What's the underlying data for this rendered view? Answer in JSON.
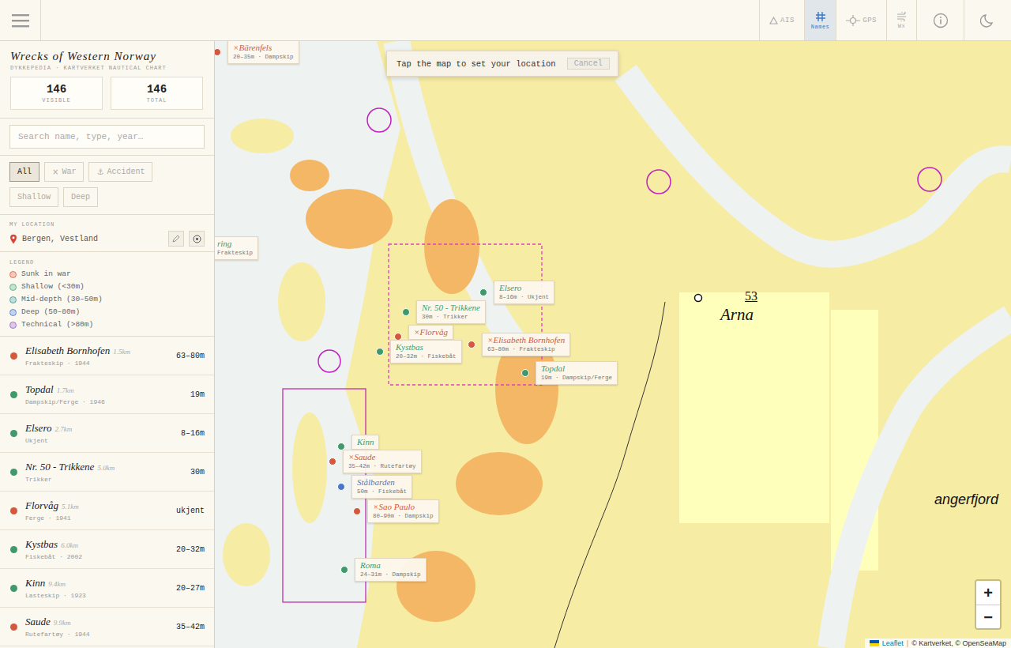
{
  "app": {
    "title": "Wrecks of Western Norway",
    "subtitle": "DYKKEPEDIA · KARTVERKET NAUTICAL CHART"
  },
  "toolbar": {
    "buttons": [
      {
        "label": "AIS",
        "selected": false
      },
      {
        "label": "Names",
        "selected": true
      },
      {
        "label": "GPS",
        "selected": false
      },
      {
        "label": "Wx",
        "selected": false
      }
    ]
  },
  "stats": [
    {
      "value": "146",
      "label": "VISIBLE"
    },
    {
      "value": "146",
      "label": "TOTAL"
    }
  ],
  "search": {
    "placeholder": "Search name, type, year…"
  },
  "filters": [
    {
      "icon": "",
      "label": "All",
      "selected": true
    },
    {
      "icon": "×",
      "label": "War",
      "selected": false
    },
    {
      "icon": "⚓",
      "label": "Accident",
      "selected": false
    },
    {
      "icon": "",
      "label": "Shallow",
      "selected": false
    },
    {
      "icon": "",
      "label": "Deep",
      "selected": false
    }
  ],
  "location": {
    "heading": "MY LOCATION",
    "value": "Bergen, Vestland"
  },
  "legend": {
    "heading": "LEGEND",
    "items": [
      {
        "label": "Sunk in war",
        "color": "#e07050"
      },
      {
        "label": "Shallow (<30m)",
        "color": "#5cb88a"
      },
      {
        "label": "Mid-depth (30–50m)",
        "color": "#4fa8a0"
      },
      {
        "label": "Deep (50–80m)",
        "color": "#5a8ad8"
      },
      {
        "label": "Technical (>80m)",
        "color": "#a070d0"
      }
    ]
  },
  "wrecks": [
    {
      "name": "Elisabeth Bornhofen",
      "distance": "1.5km",
      "meta": "Frakteskip · 1944",
      "depth": "63–80m",
      "color": "#d4583b"
    },
    {
      "name": "Topdal",
      "distance": "1.7km",
      "meta": "Dampskip/Ferge · 1946",
      "depth": "19m",
      "color": "#3e9a6a"
    },
    {
      "name": "Elsero",
      "distance": "2.7km",
      "meta": "Ukjent",
      "depth": "8–16m",
      "color": "#3e9a6a"
    },
    {
      "name": "Nr. 50 - Trikkene",
      "distance": "5.0km",
      "meta": "Trikker",
      "depth": "30m",
      "color": "#3e9a6a"
    },
    {
      "name": "Florvåg",
      "distance": "5.1km",
      "meta": "Ferge · 1941",
      "depth": "ukjent",
      "color": "#d4583b"
    },
    {
      "name": "Kystbas",
      "distance": "6.0km",
      "meta": "Fiskebåt · 2002",
      "depth": "20–32m",
      "color": "#3e9a6a"
    },
    {
      "name": "Kinn",
      "distance": "9.4km",
      "meta": "Lasteskip · 1923",
      "depth": "20–27m",
      "color": "#3e9a6a"
    },
    {
      "name": "Saude",
      "distance": "9.9km",
      "meta": "Rutefartøy · 1944",
      "depth": "35–42m",
      "color": "#d4583b"
    }
  ],
  "map": {
    "war_mark": "×",
    "markers": [
      {
        "name": "Bärenfels",
        "detail": "20–35m · Dampskip",
        "war": true,
        "color": "#d4583b"
      },
      {
        "name": "ring",
        "detail": "Frakteskip",
        "war": false,
        "color": "#3e9a6a"
      },
      {
        "name": "Elsero",
        "detail": "8–16m · Ukjent",
        "war": false,
        "color": "#3e9a6a"
      },
      {
        "name": "Nr. 50 - Trikkene",
        "detail": "30m · Trikker",
        "war": false,
        "color": "#3e9a6a"
      },
      {
        "name": "Florvåg",
        "detail": "",
        "war": true,
        "color": "#d4583b"
      },
      {
        "name": "Kystbas",
        "detail": "20–32m · Fiskebåt",
        "war": false,
        "color": "#3e9a6a"
      },
      {
        "name": "Elisabeth Bornhofen",
        "detail": "63–80m · Frakteskip",
        "war": true,
        "color": "#d4583b"
      },
      {
        "name": "Topdal",
        "detail": "19m · Dampskip/Ferge",
        "war": false,
        "color": "#3e9a6a"
      },
      {
        "name": "Kinn",
        "detail": "",
        "war": false,
        "color": "#3e9a6a"
      },
      {
        "name": "Saude",
        "detail": "35–42m · Rutefartøy",
        "war": true,
        "color": "#d4583b"
      },
      {
        "name": "Stålbarden",
        "detail": "50m · Fiskebåt",
        "war": false,
        "color": "#4a78c8"
      },
      {
        "name": "Sao Paulo",
        "detail": "80–90m · Dampskip",
        "war": true,
        "color": "#d4583b"
      },
      {
        "name": "Roma",
        "detail": "24–31m · Dampskip",
        "war": false,
        "color": "#3e9a6a"
      }
    ],
    "place_labels": [
      {
        "text": "Arna"
      },
      {
        "text": "53"
      },
      {
        "text": "angerfjord"
      }
    ],
    "prompt": {
      "text": "Tap the map to set your location",
      "cancel": "Cancel"
    },
    "zoom": {
      "in": "+",
      "out": "−"
    },
    "attribution": {
      "leaflet": "Leaflet",
      "separator": "|",
      "credits": "© Kartverket, © OpenSeaMap"
    }
  }
}
